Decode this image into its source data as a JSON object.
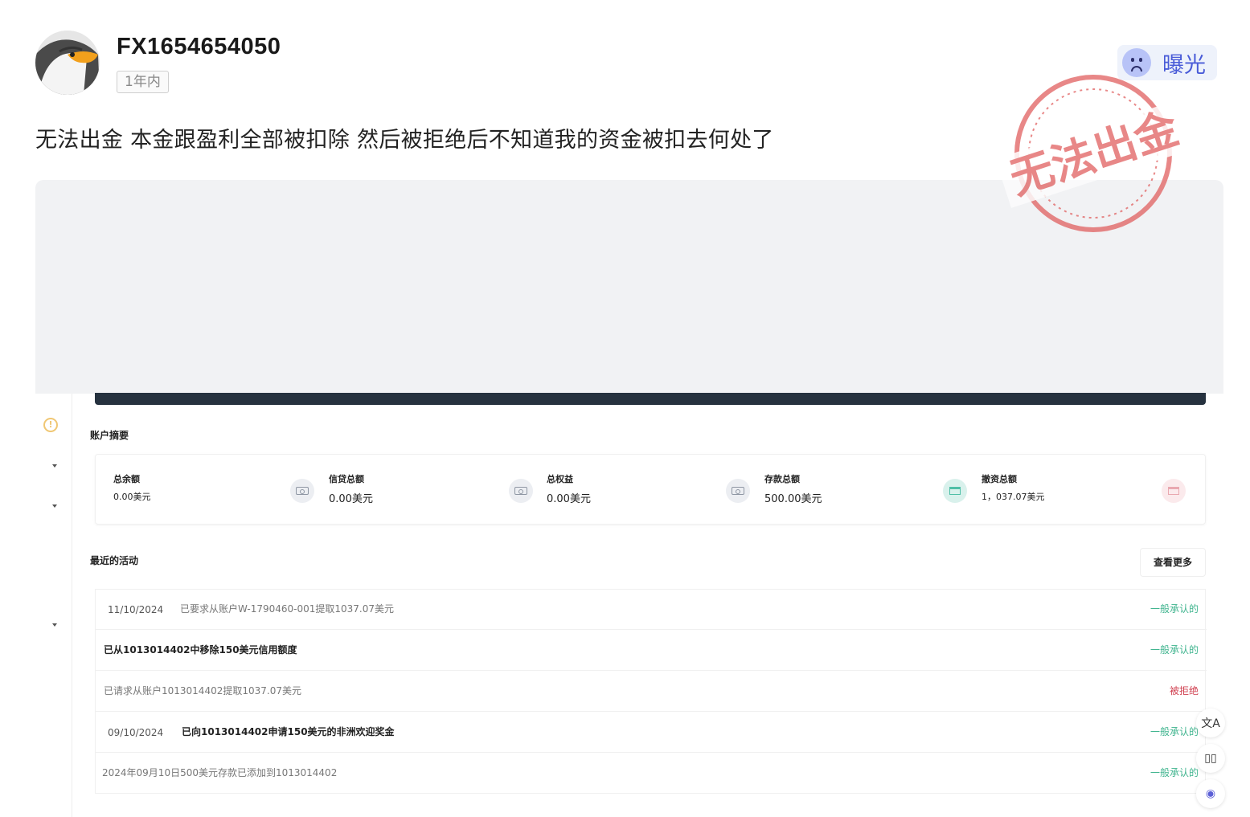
{
  "post": {
    "username": "FX1654654050",
    "time_badge": "1年内",
    "expose_label": "曝光",
    "text": "无法出金 本金跟盈利全部被扣除 然后被拒绝后不知道我的资金被扣去何处了",
    "stamp_text": "无法出金"
  },
  "screenshot": {
    "summary_title": "账户摘要",
    "stats": [
      {
        "label": "总余额",
        "value": "0.00美元"
      },
      {
        "label": "信贷总额",
        "value": "0.00美元"
      },
      {
        "label": "总权益",
        "value": "0.00美元"
      },
      {
        "label": "存款总额",
        "value": "500.00美元"
      },
      {
        "label": "撤资总额",
        "value": "1，037.07美元"
      }
    ],
    "activity_title": "最近的活动",
    "more_label": "查看更多",
    "activities": [
      {
        "date": "11/10/2024",
        "text": "已要求从账户W-1790460-001提取1037.07美元",
        "status": "一般承认的"
      },
      {
        "date": "",
        "text": "已从1013014402中移除150美元信用额度",
        "status": "一般承认的"
      },
      {
        "date": "",
        "text": "已请求从账户1013014402提取1037.07美元",
        "status": "被拒绝"
      },
      {
        "date": "09/10/2024",
        "text": "已向1013014402申请150美元的非洲欢迎奖金",
        "status": "一般承认的"
      },
      {
        "date": "",
        "text": "2024年09月10日500美元存款已添加到1013014402",
        "status": "一般承认的"
      }
    ]
  },
  "icons": {
    "avatar": "eagle-avatar-icon",
    "expose": "sad-face-icon",
    "tools": [
      "translate-icon",
      "reader-icon",
      "assistant-icon"
    ]
  },
  "colors": {
    "expose_text": "#4a5cd8",
    "stamp": "#e05a5a",
    "approved": "#3fb48e",
    "rejected": "#d04050"
  }
}
